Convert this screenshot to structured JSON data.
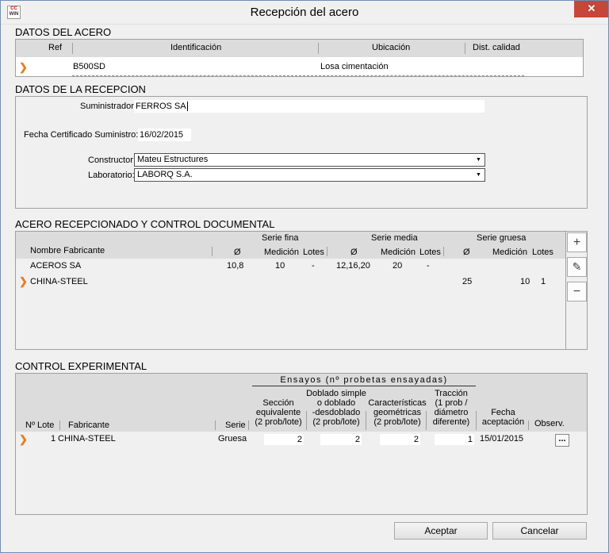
{
  "window": {
    "title": "Recepción del acero",
    "icon_text_top": "CC",
    "icon_text_bottom": "WIN",
    "close_glyph": "✕"
  },
  "datos_acero": {
    "label": "DATOS DEL ACERO",
    "columns": [
      "Ref",
      "Identificación",
      "Ubicación",
      "Dist. calidad"
    ],
    "row": {
      "ref": "",
      "identificacion": "B500SD",
      "ubicacion": "Losa cimentación",
      "dist_calidad": ""
    }
  },
  "datos_recepcion": {
    "label": "DATOS DE LA RECEPCION",
    "suministrador_label": "Suministrador:",
    "suministrador_value": "FERROS SA",
    "fecha_label": "Fecha Certificado Suministro:",
    "fecha_value": "16/02/2015",
    "constructor_label": "Constructor:",
    "constructor_value": "Mateu Estructures",
    "laboratorio_label": "Laboratorio:",
    "laboratorio_value": "LABORQ S.A."
  },
  "acero_recepcionado": {
    "label": "ACERO RECEPCIONADO Y CONTROL DOCUMENTAL",
    "group_headers": [
      "Serie fina",
      "Serie media",
      "Serie gruesa"
    ],
    "columns": [
      "Nombre Fabricante",
      "Ø",
      "Medición",
      "Lotes",
      "Ø",
      "Medición",
      "Lotes",
      "Ø",
      "Medición",
      "Lotes"
    ],
    "rows": [
      {
        "fabricante": "ACEROS SA",
        "f_d": "10,8",
        "f_m": "10",
        "f_l": "-",
        "m_d": "12,16,20",
        "m_m": "20",
        "m_l": "-",
        "g_d": "",
        "g_m": "",
        "g_l": ""
      },
      {
        "fabricante": "CHINA-STEEL",
        "f_d": "",
        "f_m": "",
        "f_l": "",
        "m_d": "",
        "m_m": "",
        "m_l": "",
        "g_d": "25",
        "g_m": "10",
        "g_l": "1"
      }
    ],
    "side_buttons": [
      "+",
      "✎",
      "−"
    ]
  },
  "control_experimental": {
    "label": "CONTROL EXPERIMENTAL",
    "ensayos_header": "Ensayos (nº probetas ensayadas)",
    "columns": {
      "lote": "Nº Lote",
      "fabricante": "Fabricante",
      "serie": "Serie",
      "seccion": [
        "Sección",
        "equivalente",
        "(2 prob/lote)"
      ],
      "doblado": [
        "Doblado simple",
        "o doblado",
        "-desdoblado",
        "(2 prob/lote)"
      ],
      "caracteristicas": [
        "Características",
        "geométricas",
        "(2 prob/lote)"
      ],
      "traccion": [
        "Tracción",
        "(1 prob /",
        "diámetro",
        "diferente)"
      ],
      "fecha": [
        "Fecha",
        "aceptación"
      ],
      "observ": "Observ."
    },
    "row": {
      "lote": "1",
      "fabricante": "CHINA-STEEL",
      "serie": "Gruesa",
      "seccion": "2",
      "doblado": "2",
      "caracteristicas": "2",
      "traccion": "1",
      "fecha": "15/01/2015",
      "observ_btn": "..."
    }
  },
  "buttons": {
    "accept": "Aceptar",
    "cancel": "Cancelar"
  },
  "colors": {
    "arrow": "#e87d1e",
    "close": "#c7453b",
    "header": "#dcdcdc"
  }
}
